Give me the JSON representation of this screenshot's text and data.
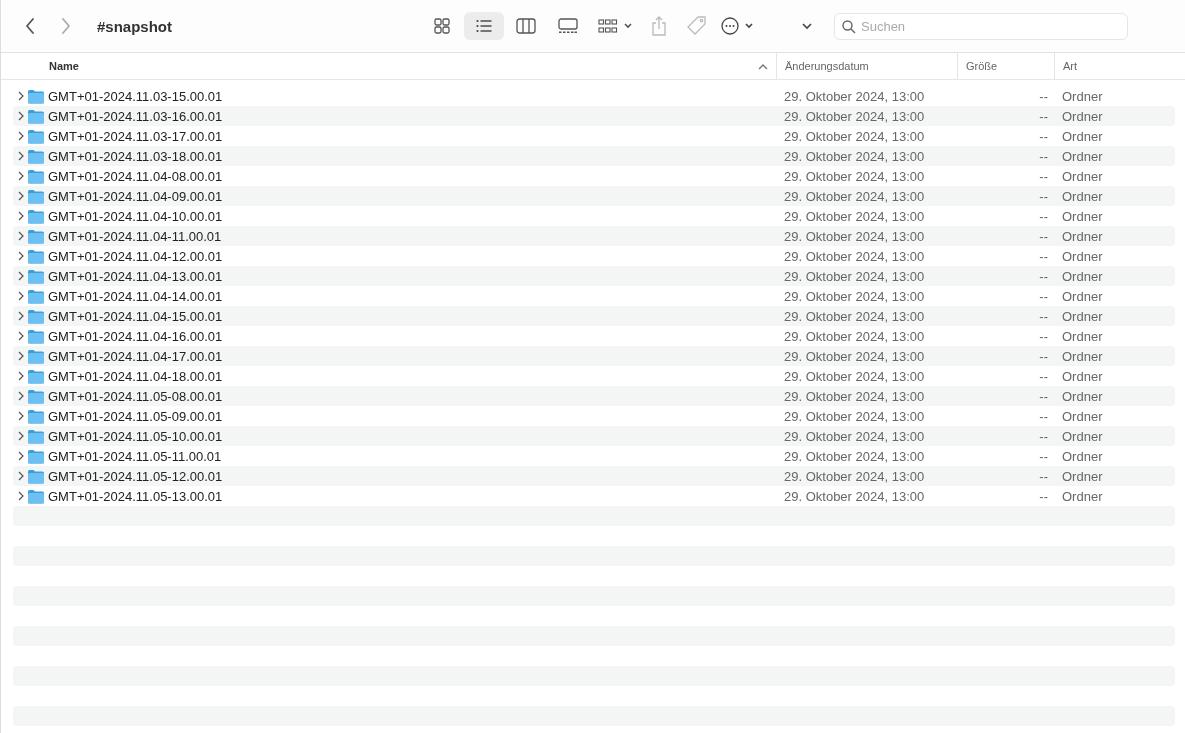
{
  "window": {
    "title": "#snapshot"
  },
  "view_modes": [
    {
      "kind": "icons",
      "selected": false
    },
    {
      "kind": "list",
      "selected": true
    },
    {
      "kind": "columns",
      "selected": false
    },
    {
      "kind": "gallery",
      "selected": false
    }
  ],
  "search": {
    "placeholder": "Suchen"
  },
  "table": {
    "columns": [
      {
        "label": "Name",
        "sorted": true
      },
      {
        "label": "Änderungsdatum",
        "sorted": false
      },
      {
        "label": "Größe",
        "sorted": false
      },
      {
        "label": "Art",
        "sorted": false
      }
    ],
    "rows": [
      {
        "name": "GMT+01-2024.11.03-15.00.01",
        "date": "29. Oktober 2024, 13:00",
        "size": "--",
        "kind": "Ordner"
      },
      {
        "name": "GMT+01-2024.11.03-16.00.01",
        "date": "29. Oktober 2024, 13:00",
        "size": "--",
        "kind": "Ordner"
      },
      {
        "name": "GMT+01-2024.11.03-17.00.01",
        "date": "29. Oktober 2024, 13:00",
        "size": "--",
        "kind": "Ordner"
      },
      {
        "name": "GMT+01-2024.11.03-18.00.01",
        "date": "29. Oktober 2024, 13:00",
        "size": "--",
        "kind": "Ordner"
      },
      {
        "name": "GMT+01-2024.11.04-08.00.01",
        "date": "29. Oktober 2024, 13:00",
        "size": "--",
        "kind": "Ordner"
      },
      {
        "name": "GMT+01-2024.11.04-09.00.01",
        "date": "29. Oktober 2024, 13:00",
        "size": "--",
        "kind": "Ordner"
      },
      {
        "name": "GMT+01-2024.11.04-10.00.01",
        "date": "29. Oktober 2024, 13:00",
        "size": "--",
        "kind": "Ordner"
      },
      {
        "name": "GMT+01-2024.11.04-11.00.01",
        "date": "29. Oktober 2024, 13:00",
        "size": "--",
        "kind": "Ordner"
      },
      {
        "name": "GMT+01-2024.11.04-12.00.01",
        "date": "29. Oktober 2024, 13:00",
        "size": "--",
        "kind": "Ordner"
      },
      {
        "name": "GMT+01-2024.11.04-13.00.01",
        "date": "29. Oktober 2024, 13:00",
        "size": "--",
        "kind": "Ordner"
      },
      {
        "name": "GMT+01-2024.11.04-14.00.01",
        "date": "29. Oktober 2024, 13:00",
        "size": "--",
        "kind": "Ordner"
      },
      {
        "name": "GMT+01-2024.11.04-15.00.01",
        "date": "29. Oktober 2024, 13:00",
        "size": "--",
        "kind": "Ordner"
      },
      {
        "name": "GMT+01-2024.11.04-16.00.01",
        "date": "29. Oktober 2024, 13:00",
        "size": "--",
        "kind": "Ordner"
      },
      {
        "name": "GMT+01-2024.11.04-17.00.01",
        "date": "29. Oktober 2024, 13:00",
        "size": "--",
        "kind": "Ordner"
      },
      {
        "name": "GMT+01-2024.11.04-18.00.01",
        "date": "29. Oktober 2024, 13:00",
        "size": "--",
        "kind": "Ordner"
      },
      {
        "name": "GMT+01-2024.11.05-08.00.01",
        "date": "29. Oktober 2024, 13:00",
        "size": "--",
        "kind": "Ordner"
      },
      {
        "name": "GMT+01-2024.11.05-09.00.01",
        "date": "29. Oktober 2024, 13:00",
        "size": "--",
        "kind": "Ordner"
      },
      {
        "name": "GMT+01-2024.11.05-10.00.01",
        "date": "29. Oktober 2024, 13:00",
        "size": "--",
        "kind": "Ordner"
      },
      {
        "name": "GMT+01-2024.11.05-11.00.01",
        "date": "29. Oktober 2024, 13:00",
        "size": "--",
        "kind": "Ordner"
      },
      {
        "name": "GMT+01-2024.11.05-12.00.01",
        "date": "29. Oktober 2024, 13:00",
        "size": "--",
        "kind": "Ordner"
      },
      {
        "name": "GMT+01-2024.11.05-13.00.01",
        "date": "29. Oktober 2024, 13:00",
        "size": "--",
        "kind": "Ordner"
      }
    ]
  }
}
